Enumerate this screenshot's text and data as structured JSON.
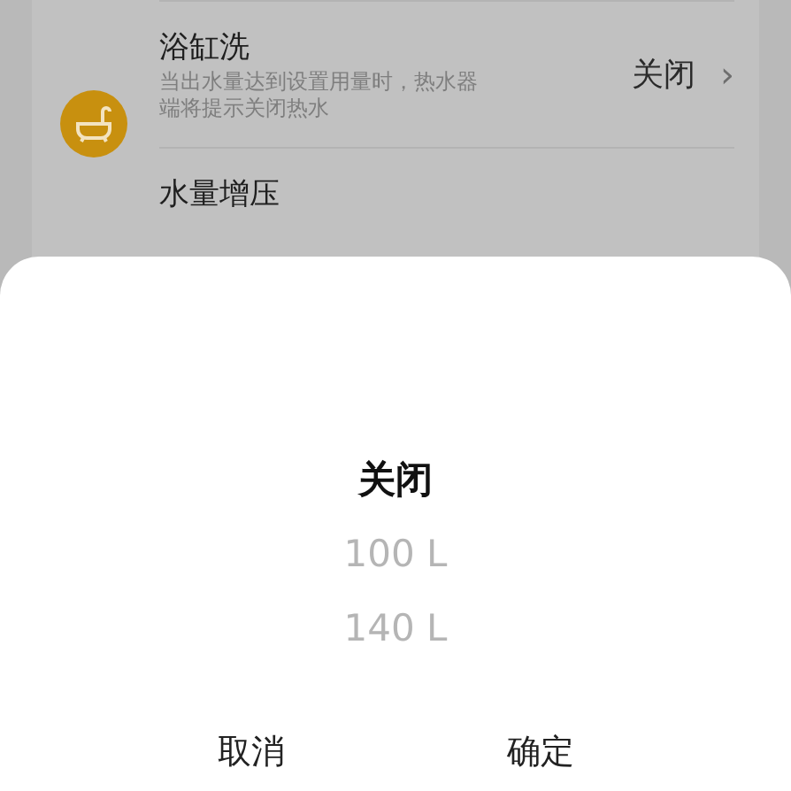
{
  "settings": [
    {
      "title": "浴缸洗",
      "description": "当出水量达到设置用量时，热水器端将提示关闭热水",
      "value": "关闭",
      "chevron": "›"
    },
    {
      "title": "水量增压"
    }
  ],
  "picker": {
    "options": [
      {
        "label": "关闭",
        "selected": true
      },
      {
        "label": "100 L",
        "selected": false
      },
      {
        "label": "140 L",
        "selected": false
      }
    ]
  },
  "buttons": [
    "取消",
    "确定"
  ]
}
